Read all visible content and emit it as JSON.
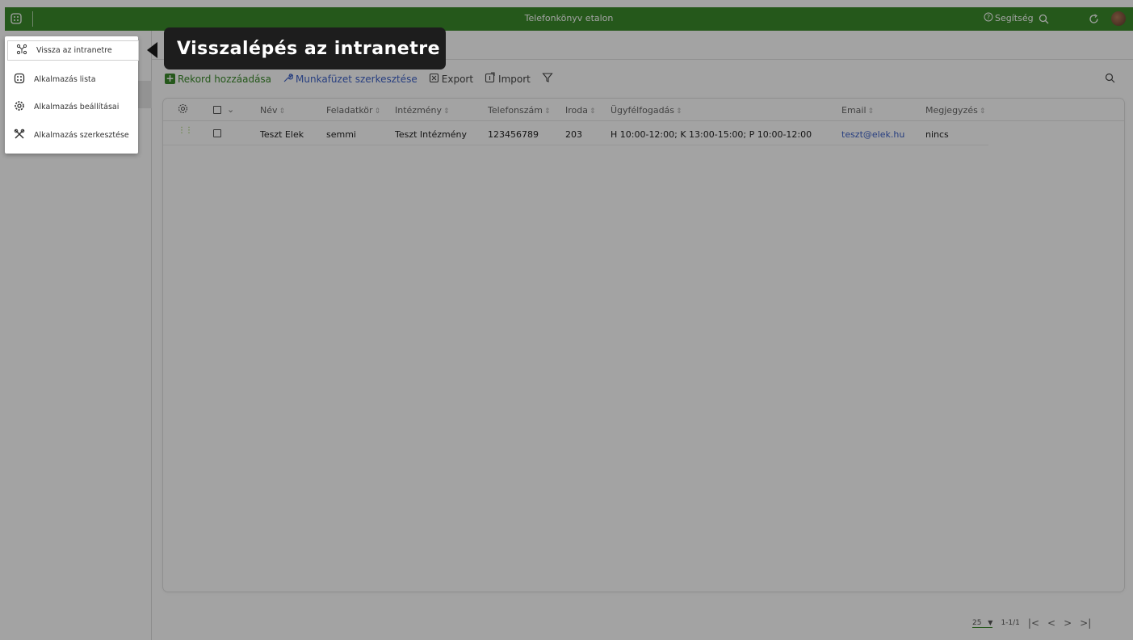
{
  "header": {
    "title": "Telefonkönyv etalon",
    "help_label": "Segítség",
    "icons": [
      "apps-icon",
      "help-icon",
      "search-icon",
      "refresh-icon",
      "user-avatar"
    ]
  },
  "toolbar": {
    "add_label": "Rekord hozzáadása",
    "edit_label": "Munkafüzet szerkesztése",
    "export_label": "Export",
    "import_label": "Import"
  },
  "table": {
    "columns": [
      "Név",
      "Feladatkör",
      "Intézmény",
      "Telefonszám",
      "Iroda",
      "Ügyfélfogadás",
      "Email",
      "Megjegyzés"
    ],
    "rows": [
      {
        "nev": "Teszt Elek",
        "feladatkor": "semmi",
        "intezmeny": "Teszt Intézmény",
        "telefonszam": "123456789",
        "iroda": "203",
        "ugyfelfogadas": "H 10:00-12:00; K 13:00-15:00; P 10:00-12:00",
        "email": "teszt@elek.hu",
        "megjegyzes": "nincs"
      }
    ]
  },
  "pagination": {
    "page_size": "25",
    "range": "1-1/1"
  },
  "menu": {
    "items": [
      {
        "label": "Vissza az intranetre",
        "icon": "back-network-icon"
      },
      {
        "label": "Alkalmazás lista",
        "icon": "apps-icon"
      },
      {
        "label": "Alkalmazás beállításai",
        "icon": "gear-icon"
      },
      {
        "label": "Alkalmazás szerkesztése",
        "icon": "tools-icon"
      }
    ]
  },
  "tooltip": {
    "text": "Visszalépés az intranetre"
  },
  "colors": {
    "brand_green": "#3a8a2b",
    "link_blue": "#3f63c8"
  }
}
